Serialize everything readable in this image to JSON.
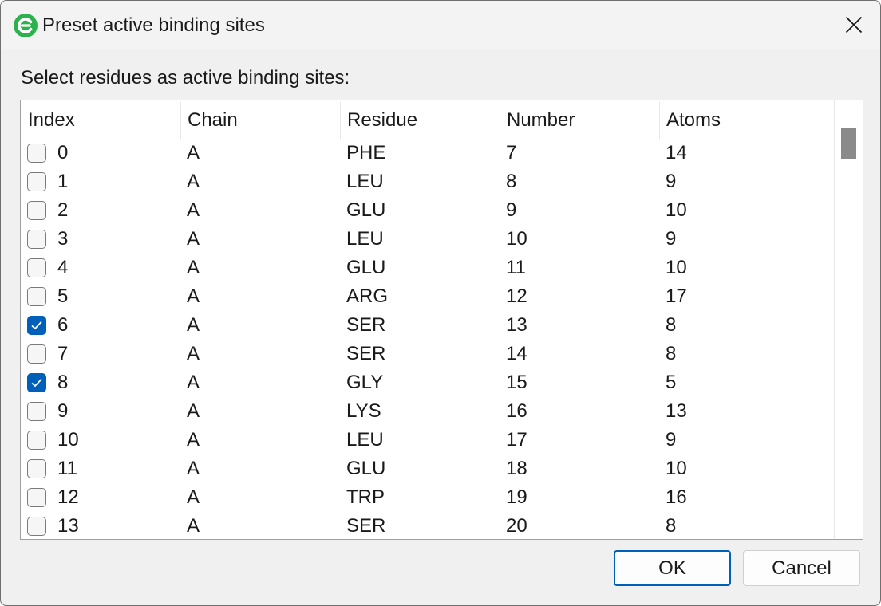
{
  "window": {
    "title": "Preset active binding sites",
    "accent_color": "#005fb8",
    "icon": "app-logo-icon"
  },
  "prompt": "Select residues as active binding sites:",
  "table": {
    "columns": [
      "Index",
      "Chain",
      "Residue",
      "Number",
      "Atoms"
    ],
    "rows": [
      {
        "index": "0",
        "chain": "A",
        "residue": "PHE",
        "number": "7",
        "atoms": "14",
        "checked": false
      },
      {
        "index": "1",
        "chain": "A",
        "residue": "LEU",
        "number": "8",
        "atoms": "9",
        "checked": false
      },
      {
        "index": "2",
        "chain": "A",
        "residue": "GLU",
        "number": "9",
        "atoms": "10",
        "checked": false
      },
      {
        "index": "3",
        "chain": "A",
        "residue": "LEU",
        "number": "10",
        "atoms": "9",
        "checked": false
      },
      {
        "index": "4",
        "chain": "A",
        "residue": "GLU",
        "number": "11",
        "atoms": "10",
        "checked": false
      },
      {
        "index": "5",
        "chain": "A",
        "residue": "ARG",
        "number": "12",
        "atoms": "17",
        "checked": false
      },
      {
        "index": "6",
        "chain": "A",
        "residue": "SER",
        "number": "13",
        "atoms": "8",
        "checked": true
      },
      {
        "index": "7",
        "chain": "A",
        "residue": "SER",
        "number": "14",
        "atoms": "8",
        "checked": false
      },
      {
        "index": "8",
        "chain": "A",
        "residue": "GLY",
        "number": "15",
        "atoms": "5",
        "checked": true
      },
      {
        "index": "9",
        "chain": "A",
        "residue": "LYS",
        "number": "16",
        "atoms": "13",
        "checked": false
      },
      {
        "index": "10",
        "chain": "A",
        "residue": "LEU",
        "number": "17",
        "atoms": "9",
        "checked": false
      },
      {
        "index": "11",
        "chain": "A",
        "residue": "GLU",
        "number": "18",
        "atoms": "10",
        "checked": false
      },
      {
        "index": "12",
        "chain": "A",
        "residue": "TRP",
        "number": "19",
        "atoms": "16",
        "checked": false
      },
      {
        "index": "13",
        "chain": "A",
        "residue": "SER",
        "number": "20",
        "atoms": "8",
        "checked": false
      }
    ]
  },
  "buttons": {
    "ok": "OK",
    "cancel": "Cancel"
  }
}
